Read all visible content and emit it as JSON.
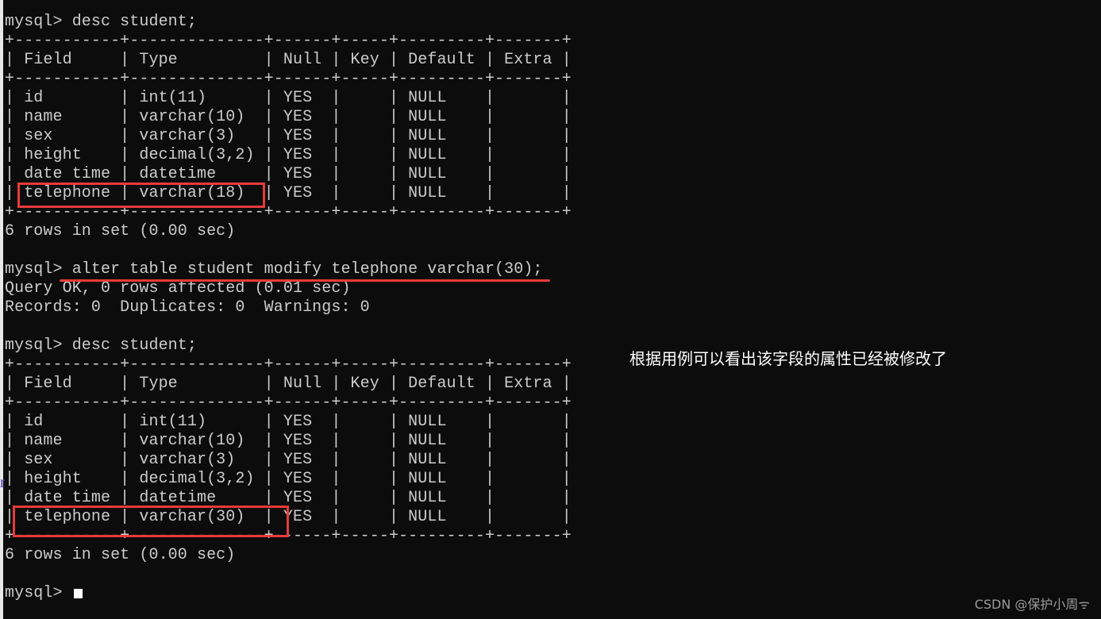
{
  "terminal": {
    "prompt": "mysql> ",
    "lines": [
      "mysql> desc student;",
      "+-----------+--------------+------+-----+---------+-------+",
      "| Field     | Type         | Null | Key | Default | Extra |",
      "+-----------+--------------+------+-----+---------+-------+",
      "| id        | int(11)      | YES  |     | NULL    |       |",
      "| name      | varchar(10)  | YES  |     | NULL    |       |",
      "| sex       | varchar(3)   | YES  |     | NULL    |       |",
      "| height    | decimal(3,2) | YES  |     | NULL    |       |",
      "| date time | datetime     | YES  |     | NULL    |       |",
      "| telephone | varchar(18)  | YES  |     | NULL    |       |",
      "+-----------+--------------+------+-----+---------+-------+",
      "6 rows in set (0.00 sec)",
      "",
      "mysql> alter table student modify telephone varchar(30);",
      "Query OK, 0 rows affected (0.01 sec)",
      "Records: 0  Duplicates: 0  Warnings: 0",
      "",
      "mysql> desc student;",
      "+-----------+--------------+------+-----+---------+-------+",
      "| Field     | Type         | Null | Key | Default | Extra |",
      "+-----------+--------------+------+-----+---------+-------+",
      "| id        | int(11)      | YES  |     | NULL    |       |",
      "| name      | varchar(10)  | YES  |     | NULL    |       |",
      "| sex       | varchar(3)   | YES  |     | NULL    |       |",
      "| height    | decimal(3,2) | YES  |     | NULL    |       |",
      "| date time | datetime     | YES  |     | NULL    |       |",
      "| telephone | varchar(30)  | YES  |     | NULL    |       |",
      "+-----------+--------------+------+-----+---------+-------+",
      "6 rows in set (0.00 sec)",
      "",
      "mysql> "
    ],
    "tables": [
      {
        "columns": [
          "Field",
          "Type",
          "Null",
          "Key",
          "Default",
          "Extra"
        ],
        "rows": [
          [
            "id",
            "int(11)",
            "YES",
            "",
            "NULL",
            ""
          ],
          [
            "name",
            "varchar(10)",
            "YES",
            "",
            "NULL",
            ""
          ],
          [
            "sex",
            "varchar(3)",
            "YES",
            "",
            "NULL",
            ""
          ],
          [
            "height",
            "decimal(3,2)",
            "YES",
            "",
            "NULL",
            ""
          ],
          [
            "date time",
            "datetime",
            "YES",
            "",
            "NULL",
            ""
          ],
          [
            "telephone",
            "varchar(18)",
            "YES",
            "",
            "NULL",
            ""
          ]
        ],
        "footer": "6 rows in set (0.00 sec)"
      },
      {
        "columns": [
          "Field",
          "Type",
          "Null",
          "Key",
          "Default",
          "Extra"
        ],
        "rows": [
          [
            "id",
            "int(11)",
            "YES",
            "",
            "NULL",
            ""
          ],
          [
            "name",
            "varchar(10)",
            "YES",
            "",
            "NULL",
            ""
          ],
          [
            "sex",
            "varchar(3)",
            "YES",
            "",
            "NULL",
            ""
          ],
          [
            "height",
            "decimal(3,2)",
            "YES",
            "",
            "NULL",
            ""
          ],
          [
            "date time",
            "datetime",
            "YES",
            "",
            "NULL",
            ""
          ],
          [
            "telephone",
            "varchar(30)",
            "YES",
            "",
            "NULL",
            ""
          ]
        ],
        "footer": "6 rows in set (0.00 sec)"
      }
    ]
  },
  "annotation": "根据用例可以看出该字段的属性已经被修改了",
  "watermark": "CSDN @保护小周ᯤ",
  "left_strip_glyph": "r",
  "colors": {
    "background": "#0c0c0c",
    "text": "#cccccc",
    "highlight_red": "#e83a3a",
    "annotation_text": "#ffffff",
    "watermark_text": "#9a9a9a"
  }
}
